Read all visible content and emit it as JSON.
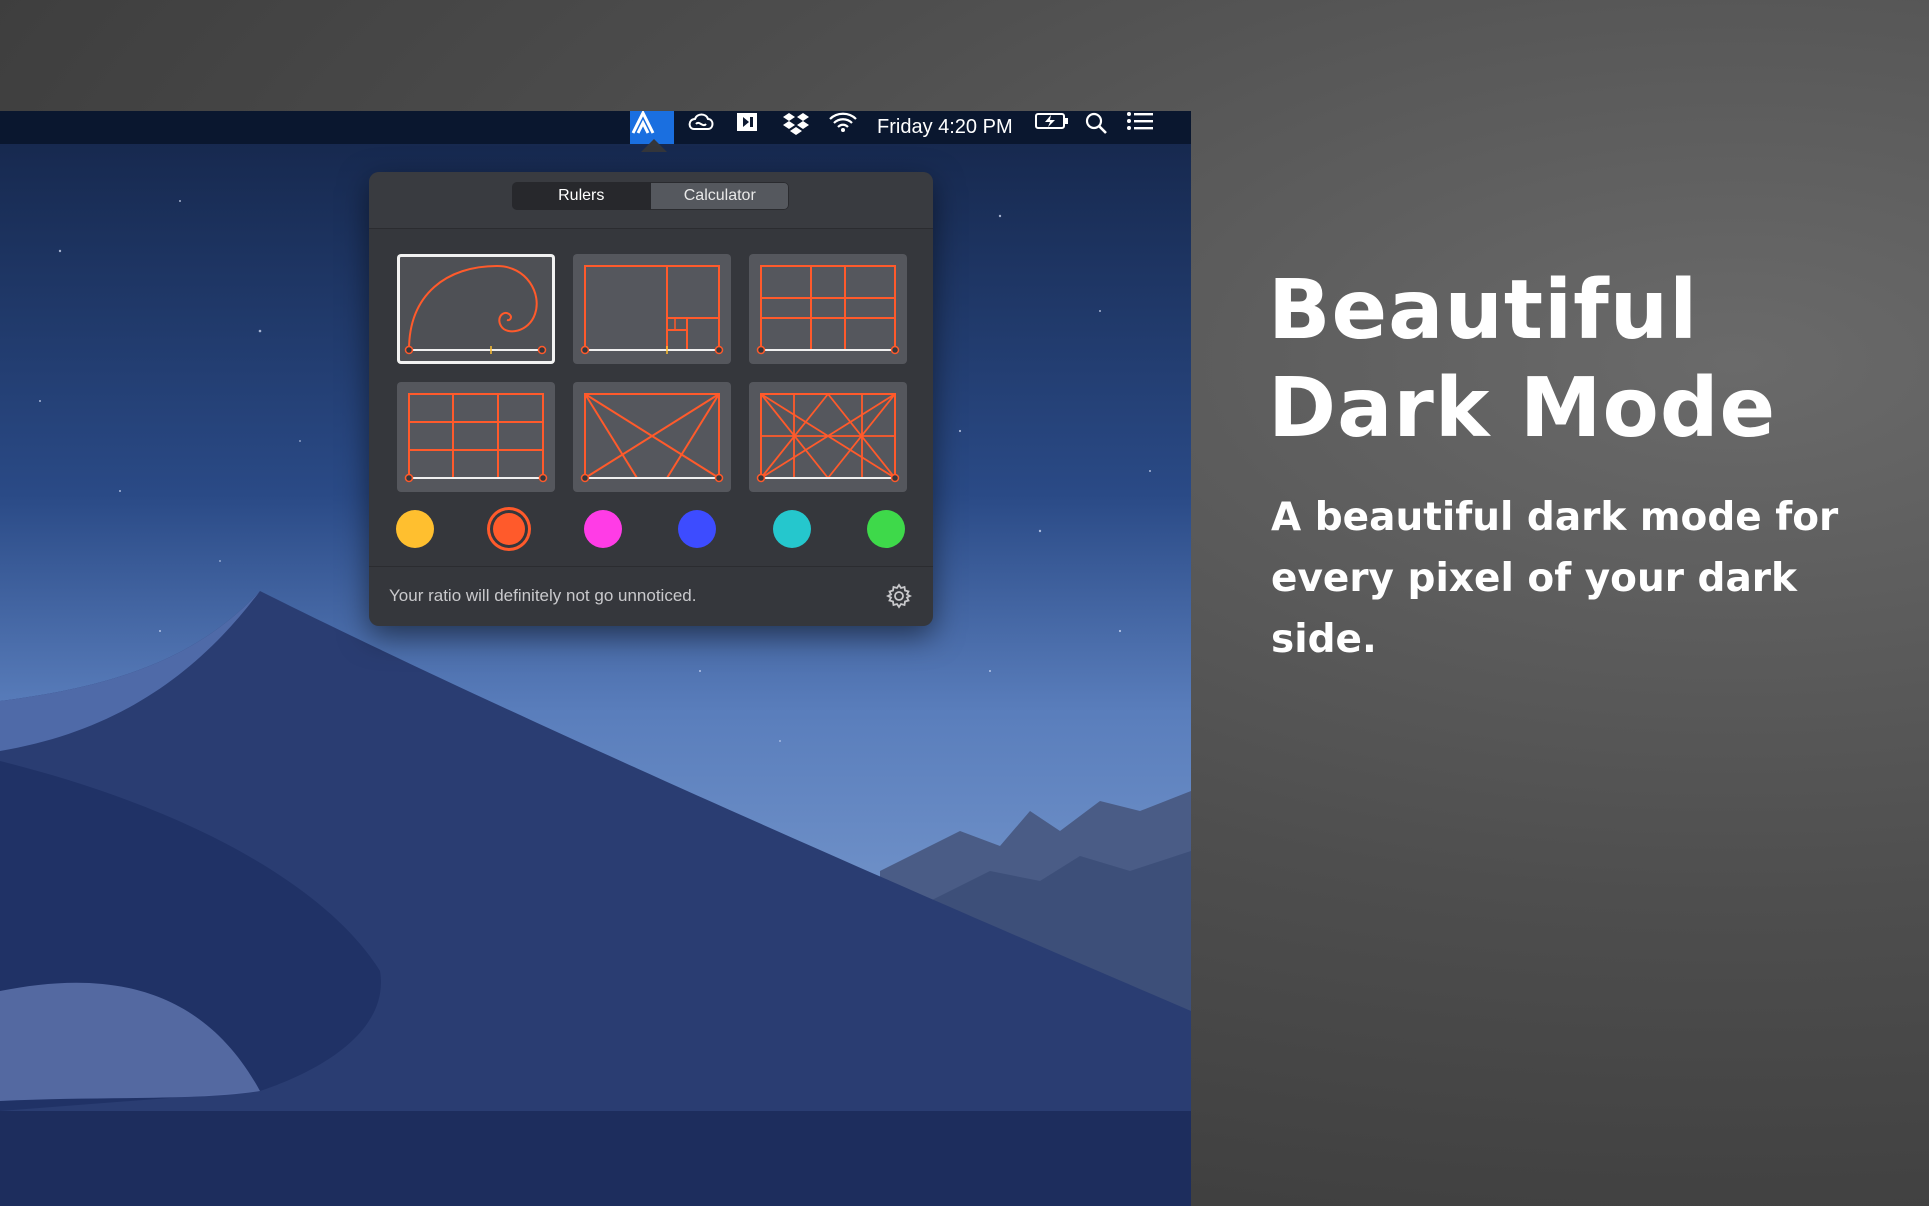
{
  "menubar": {
    "app_icon": "golden-ratio-app-icon",
    "status_icons": [
      "creative-cloud-icon",
      "screen-capture-icon",
      "dropbox-icon",
      "wifi-icon"
    ],
    "clock": "Friday 4:20 PM",
    "right_icons": [
      "battery-charging-icon",
      "spotlight-search-icon",
      "notification-center-icon"
    ]
  },
  "popover": {
    "tabs": [
      {
        "label": "Rulers",
        "selected": true
      },
      {
        "label": "Calculator",
        "selected": false
      }
    ],
    "grid_options": [
      {
        "name": "golden-spiral",
        "selected": true
      },
      {
        "name": "golden-rectangle",
        "selected": false
      },
      {
        "name": "phi-grid",
        "selected": false
      },
      {
        "name": "rule-of-thirds",
        "selected": false
      },
      {
        "name": "diagonals",
        "selected": false
      },
      {
        "name": "harmonic-armature",
        "selected": false
      }
    ],
    "colors": [
      {
        "name": "yellow",
        "hex": "#ffbf2f",
        "selected": false
      },
      {
        "name": "orange",
        "hex": "#ff5a2b",
        "selected": true
      },
      {
        "name": "magenta",
        "hex": "#ff3ce6",
        "selected": false
      },
      {
        "name": "blue",
        "hex": "#3d4cff",
        "selected": false
      },
      {
        "name": "teal",
        "hex": "#25c7cd",
        "selected": false
      },
      {
        "name": "green",
        "hex": "#3ed94a",
        "selected": false
      }
    ],
    "footer_text": "Your ratio will definitely not go unnoticed.",
    "settings_icon": "gear-icon"
  },
  "marketing": {
    "headline_line1": "Beautiful",
    "headline_line2": "Dark Mode",
    "subline": "A beautiful dark mode for every pixel of your dark side."
  },
  "accent_color": "#ff5a2b"
}
